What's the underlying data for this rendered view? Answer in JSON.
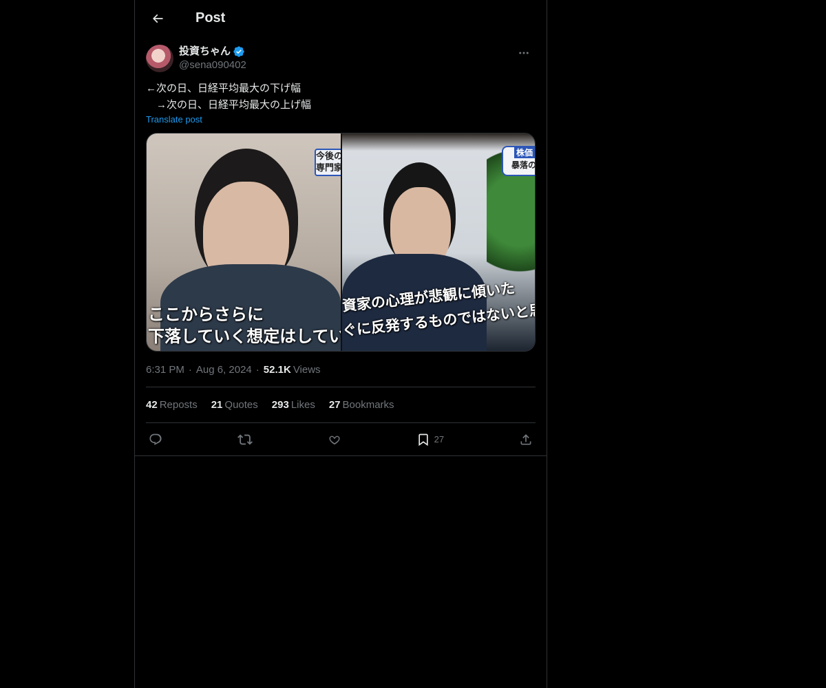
{
  "header": {
    "title": "Post"
  },
  "author": {
    "display_name": "投資ちゃん",
    "handle": "@sena090402",
    "verified": true
  },
  "post": {
    "text_line1": "←次の日、日経平均最大の下げ幅",
    "text_line2": "　→次の日、日経平均最大の上げ幅",
    "translate_label": "Translate post",
    "media": {
      "left_subtitle_1": "ここからさらに",
      "left_subtitle_2": "下落していく想定はしていな",
      "left_caption": "今後の\n専門家",
      "right_subtitle_1": "資家の心理が悲観に傾いた",
      "right_subtitle_2": "ぐに反発するものではないと思",
      "right_caption_1": "株価",
      "right_caption_2": "暴落の"
    },
    "time": "6:31 PM",
    "date": "Aug 6, 2024",
    "views_count": "52.1K",
    "views_label": "Views"
  },
  "stats": {
    "reposts_count": "42",
    "reposts_label": "Reposts",
    "quotes_count": "21",
    "quotes_label": "Quotes",
    "likes_count": "293",
    "likes_label": "Likes",
    "bookmarks_count": "27",
    "bookmarks_label": "Bookmarks"
  },
  "actions": {
    "bookmark_count": "27"
  },
  "colors": {
    "background": "#000000",
    "border": "#2f3336",
    "text_primary": "#e7e9ea",
    "text_secondary": "#71767b",
    "accent": "#1d9bf0"
  },
  "icons": {
    "back": "back-arrow-icon",
    "verified": "verified-badge-icon",
    "more": "more-icon",
    "reply": "reply-icon",
    "repost": "repost-icon",
    "like": "heart-icon",
    "bookmark": "bookmark-icon",
    "share": "share-icon"
  }
}
